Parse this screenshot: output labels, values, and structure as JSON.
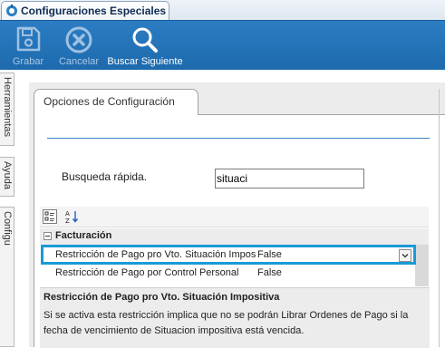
{
  "window_tab": {
    "title": "Configuraciones Especiales",
    "icon": "config-gear-icon"
  },
  "toolbar": {
    "save": {
      "label": "Grabar",
      "icon": "floppy-disk-icon",
      "enabled": false
    },
    "cancel": {
      "label": "Cancelar",
      "icon": "cancel-circle-icon",
      "enabled": false
    },
    "find_next": {
      "label": "Buscar Siguiente",
      "icon": "magnifier-icon",
      "enabled": true
    }
  },
  "side_tabs": [
    "Herramientas",
    "Ayuda",
    "Configu"
  ],
  "page": {
    "tab_label": "Opciones de Configuración",
    "search_label": "Busqueda rápida.",
    "search_value": "situaci"
  },
  "property_grid": {
    "category": "Facturación",
    "rows": [
      {
        "name": "Restricción de Pago pro Vto. Situación Impositiva",
        "value": "False",
        "selected": true
      },
      {
        "name": "Restricción de Pago por Control Personal",
        "value": "False",
        "selected": false
      }
    ]
  },
  "description": {
    "title": "Restricción de Pago pro Vto. Situación Impositiva",
    "text": "Si se activa esta restricción implica que no se podrán Librar Ordenes de Pago si la fecha de vencimiento de Situacion impositiva está vencida."
  },
  "colors": {
    "toolbar": "#1d6aad",
    "selection": "#1b9ad6",
    "rule": "#3d7fc1"
  }
}
